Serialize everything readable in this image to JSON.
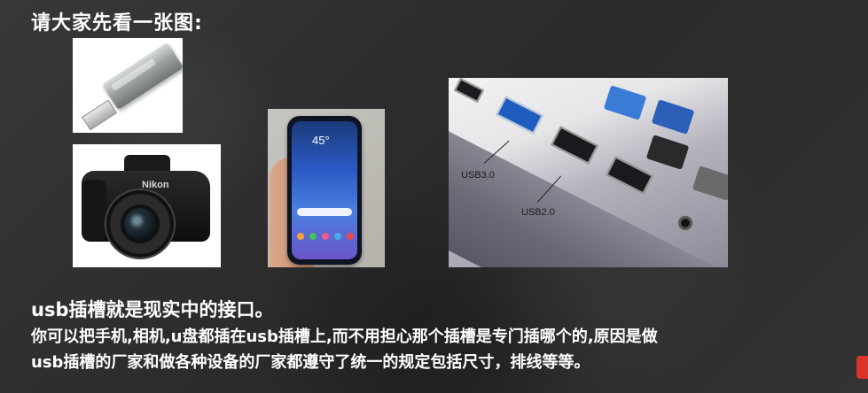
{
  "slide": {
    "title": "请大家先看一张图:",
    "heading": "usb插槽就是现实中的接口。",
    "line1": "你可以把手机,相机,u盘都插在usb插槽上,而不用担心那个插槽是专门插哪个的,原因是做",
    "line2": "usb插槽的厂家和做各种设备的厂家都遵守了统一的规定包括尺寸，排线等等。"
  },
  "images": {
    "camera_brand": "Nikon",
    "phone_time": "45°",
    "port_usb3_label": "USB3.0",
    "port_usb2_label": "USB2.0"
  },
  "colors": {
    "background": "#2f2f2f",
    "text": "#ffffff",
    "usb3_port": "#1e5dbf",
    "corner_button": "#d9332b"
  }
}
